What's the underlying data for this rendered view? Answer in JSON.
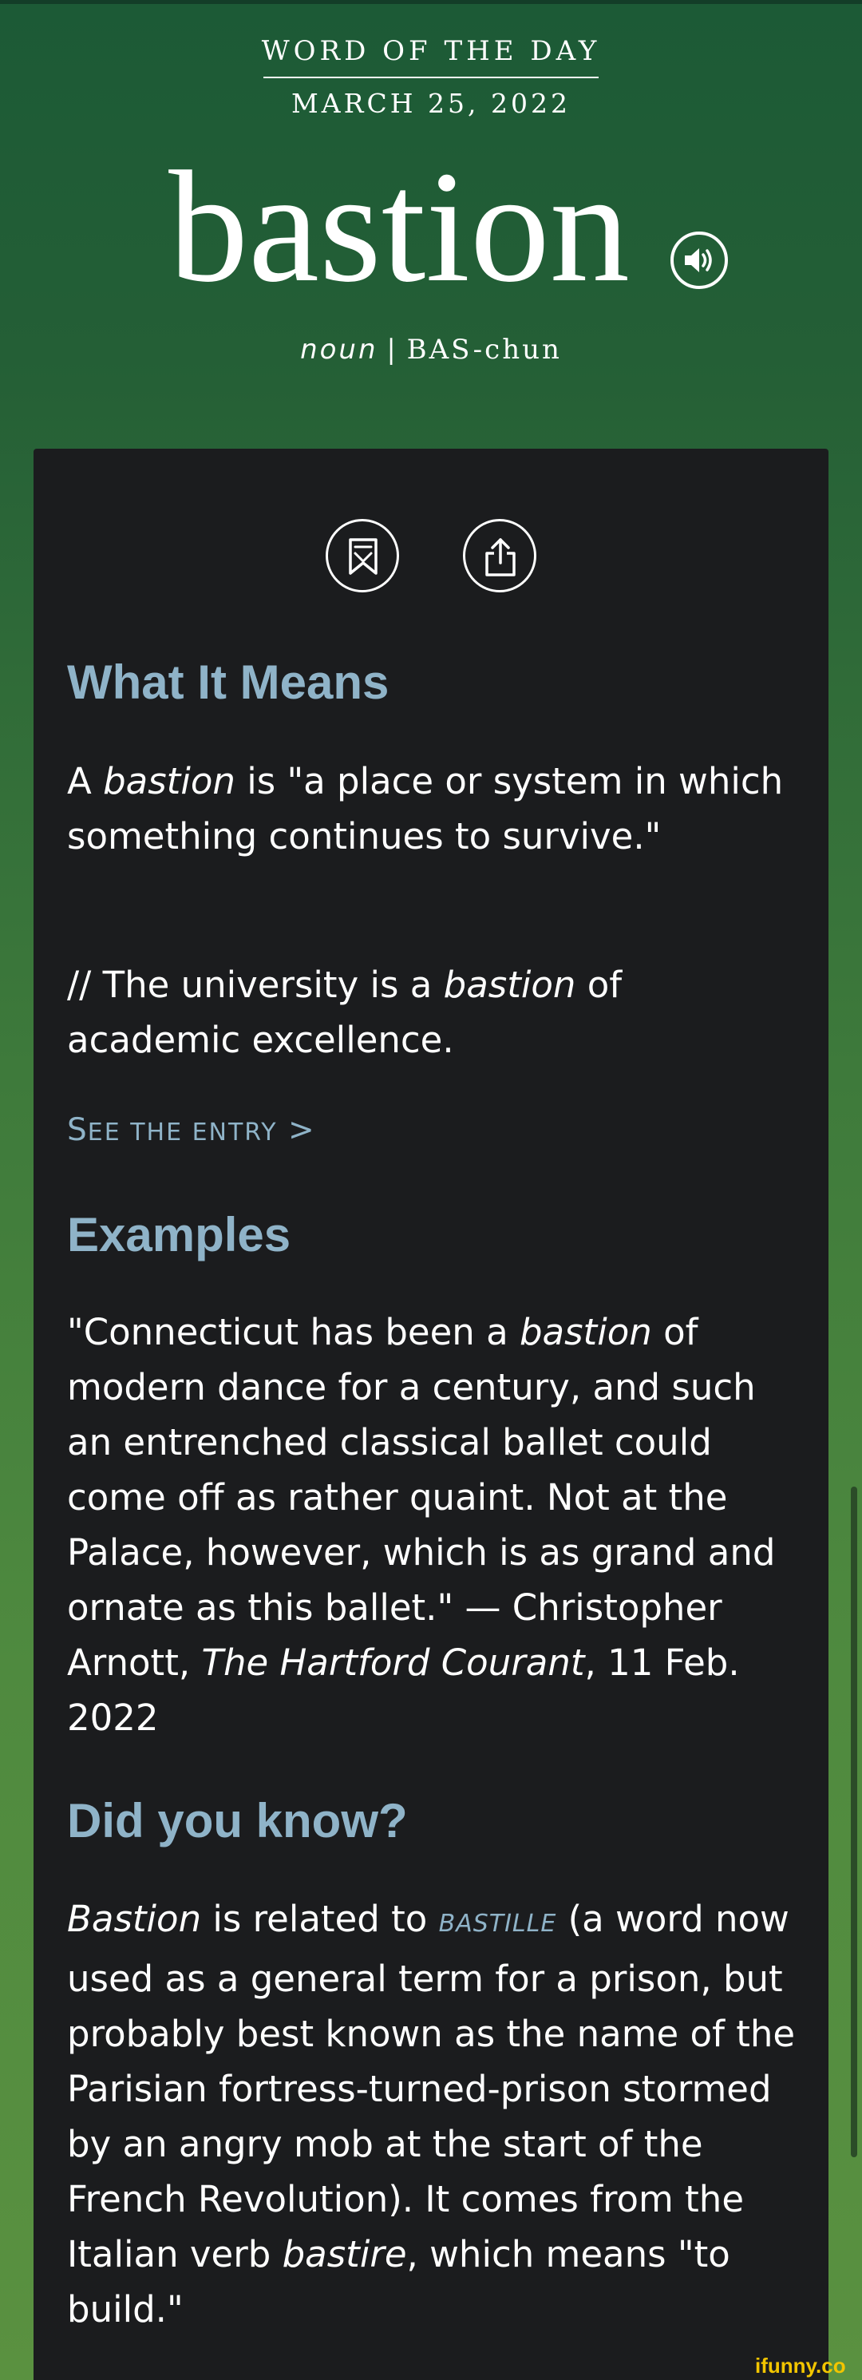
{
  "header": {
    "label": "WORD OF THE DAY",
    "date": "MARCH 25, 2022",
    "word": "bastion",
    "part_of_speech": "noun",
    "separator": "|",
    "pronunciation": "BAS-chun"
  },
  "card": {
    "meaning": {
      "heading": "What It Means",
      "def_pre": "A ",
      "def_word": "bastion",
      "def_post": " is \"a place or system in which something continues to survive.\"",
      "ex_pre": "// The university is a ",
      "ex_word": "bastion",
      "ex_post": " of academic excellence.",
      "see_entry_first": "S",
      "see_entry_rest": "EE THE ENTRY",
      "see_entry_arrow": ">"
    },
    "examples": {
      "heading": "Examples",
      "q1": "\"Connecticut has been a ",
      "q_word": "bastion",
      "q2": " of modern dance for a century, and such an entrenched classical ballet could come off as rather quaint. Not at the Palace, however, which is as grand and ornate as this ballet.\" — Christopher Arnott, ",
      "source": "The Hartford Courant",
      "date": ", 11 Feb. 2022"
    },
    "did_you_know": {
      "heading": "Did you know?",
      "word": "Bastion",
      "t1": " is related to ",
      "xref": "BASTILLE",
      "t2": " (a word now used as a general term for a prison, but probably best known as the name of the Parisian fortress-turned-prison stormed by an angry mob at the start of the French Revolution). It comes from the Italian verb ",
      "verb": "bastire",
      "t3": ", which means \"to build.\""
    }
  },
  "icons": {
    "speaker": "speaker-icon",
    "bookmark": "bookmark-icon",
    "share": "share-icon"
  },
  "watermark": "ifunny.co",
  "colors": {
    "heading": "#8fb3c8",
    "card": "#1b1c1e",
    "background_top": "#1c5a36",
    "background_bottom": "#5a9140",
    "watermark": "#f2c500"
  }
}
